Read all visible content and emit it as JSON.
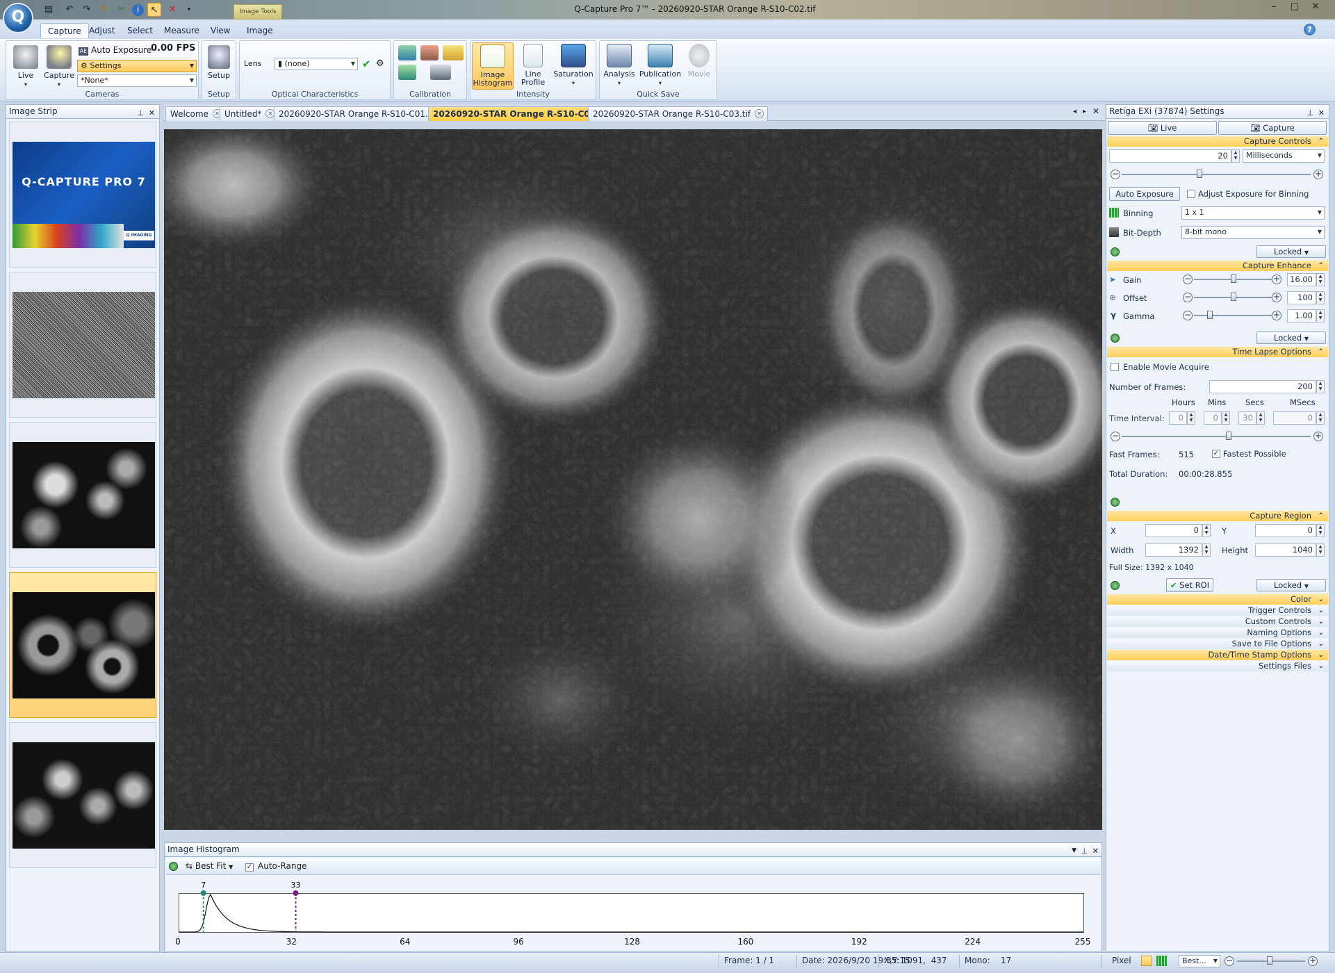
{
  "window": {
    "title": "Q-Capture Pro 7™ - 20260920-STAR Orange R-S10-C02.tif",
    "app_logo": "Q",
    "context_tab_group": "Image Tools",
    "controls": {
      "minimize": "–",
      "maximize": "□",
      "close": "✕"
    },
    "help_icon": "?"
  },
  "quick_access": [
    "new-icon",
    "undo-icon",
    "redo-icon",
    "pencil-icon",
    "crop-icon",
    "info-icon",
    "pointer-icon",
    "delete-icon",
    "customize-icon"
  ],
  "ribbon": {
    "tabs": [
      "Capture",
      "Adjust",
      "Select",
      "Measure",
      "View",
      "Image"
    ],
    "active_tab": "Capture",
    "cameras": {
      "label": "Cameras",
      "live": "Live",
      "capture": "Capture",
      "auto_exposure": "Auto Exposure",
      "fps": "0.00 FPS",
      "settings": "Settings",
      "preset": "*None*"
    },
    "setup": {
      "label": "Setup",
      "button": "Setup"
    },
    "optical": {
      "label": "Optical Characteristics",
      "lens_label": "Lens",
      "lens_value": "(none)"
    },
    "calibration": {
      "label": "Calibration"
    },
    "intensity": {
      "label": "Intensity",
      "image_histogram": "Image Histogram",
      "line_profile": "Line Profile",
      "saturation": "Saturation"
    },
    "quick_save": {
      "label": "Quick Save",
      "analysis": "Analysis",
      "publication": "Publication",
      "movie": "Movie"
    }
  },
  "image_strip": {
    "title": "Image Strip",
    "thumbnails": [
      "splash",
      "noise",
      "cells-1",
      "cells-2",
      "cells-3"
    ],
    "selected_index": 3,
    "splash_title": "Q-CAPTURE PRO 7",
    "splash_badge": "Q IMAGING"
  },
  "document_tabs": [
    {
      "label": "Welcome",
      "active": false
    },
    {
      "label": "Untitled*",
      "active": false
    },
    {
      "label": "20260920-STAR Orange R-S10-C01.tif",
      "active": false
    },
    {
      "label": "20260920-STAR Orange R-S10-C02.tif",
      "active": true
    },
    {
      "label": "20260920-STAR Orange R-S10-C03.tif",
      "active": false
    }
  ],
  "histogram": {
    "title": "Image Histogram",
    "fit_mode": "Best Fit",
    "auto_range_label": "Auto-Range",
    "auto_range_checked": true,
    "low_marker": 7,
    "high_marker": 33,
    "axis_ticks": [
      "0",
      "32",
      "64",
      "96",
      "128",
      "160",
      "192",
      "224",
      "255"
    ],
    "axis_max": 255,
    "low_color": "#1f8a80",
    "high_color": "#7a1f8a"
  },
  "settings_panel": {
    "title": "Retiga EXi (37874) Settings",
    "live_button": "Live",
    "capture_button": "Capture",
    "capture_controls": {
      "header": "Capture Controls",
      "exposure_value": "20",
      "exposure_unit": "Milliseconds",
      "auto_exposure_button": "Auto Exposure",
      "adjust_binning_label": "Adjust Exposure for Binning",
      "binning_label": "Binning",
      "binning_value": "1 x 1",
      "bit_depth_label": "Bit-Depth",
      "bit_depth_value": "8-bit mono",
      "locked": "Locked"
    },
    "capture_enhance": {
      "header": "Capture Enhance",
      "gain_label": "Gain",
      "gain_value": "16.00",
      "gain_level": 0.5,
      "offset_label": "Offset",
      "offset_value": "100",
      "offset_level": 0.5,
      "gamma_label": "Gamma",
      "gamma_value": "1.00",
      "gamma_level": 0.2,
      "locked": "Locked"
    },
    "time_lapse": {
      "header": "Time Lapse Options",
      "enable_movie": "Enable Movie Acquire",
      "frames_label": "Number of Frames:",
      "frames_value": "200",
      "col_hours": "Hours",
      "col_mins": "Mins",
      "col_secs": "Secs",
      "col_msecs": "MSecs",
      "interval_label": "Time Interval:",
      "hours": "0",
      "mins": "0",
      "secs": "30",
      "msecs": "0",
      "fast_frames_label": "Fast Frames:",
      "fast_frames_value": "515",
      "fastest_possible": "Fastest Possible",
      "total_duration_label": "Total Duration:",
      "total_duration_value": "00:00:28.855"
    },
    "capture_region": {
      "header": "Capture Region",
      "x_label": "X",
      "x_value": "0",
      "y_label": "Y",
      "y_value": "0",
      "width_label": "Width",
      "width_value": "1392",
      "height_label": "Height",
      "height_value": "1040",
      "full_size": "Full Size: 1392 x 1040",
      "set_roi": "Set ROI",
      "locked": "Locked"
    },
    "collapsed_sections": [
      "Color",
      "Trigger Controls",
      "Custom Controls",
      "Naming Options",
      "Save to File Options",
      "Date/Time Stamp Options",
      "Settings Files"
    ],
    "highlighted_collapsed": [
      "Color",
      "Date/Time Stamp Options"
    ]
  },
  "status_bar": {
    "frame": "Frame: 1 / 1",
    "date": "Date: 2026/9/20 19:35:15",
    "xy": "X,Y: 1091,  437",
    "mono": "Mono:    17",
    "unit": "Pixel",
    "zoom": "Best..."
  }
}
